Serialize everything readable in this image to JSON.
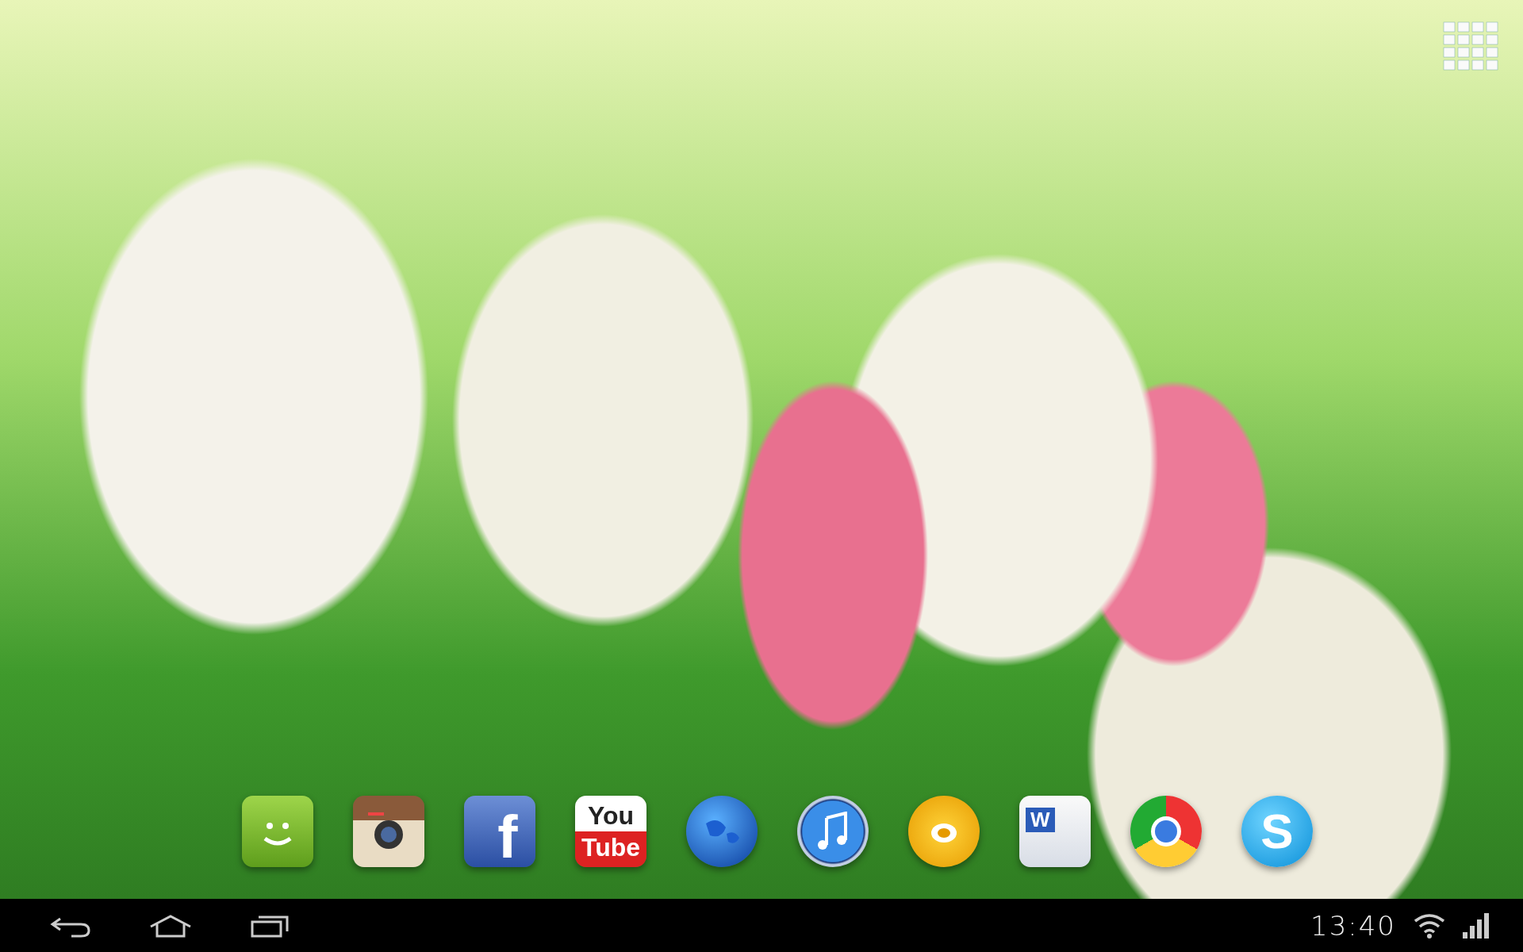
{
  "dock": [
    {
      "kind": "message"
    },
    {
      "kind": "camera"
    },
    {
      "kind": "facebook",
      "glyph": "f"
    },
    {
      "kind": "youtube",
      "lines": [
        "You",
        "Tube"
      ]
    },
    {
      "kind": "globe"
    },
    {
      "kind": "music"
    },
    {
      "kind": "player"
    },
    {
      "kind": "document",
      "glyph": "W"
    },
    {
      "kind": "chrome"
    },
    {
      "kind": "skype",
      "glyph": "S"
    }
  ],
  "status_bar": {
    "time": "13:40"
  }
}
